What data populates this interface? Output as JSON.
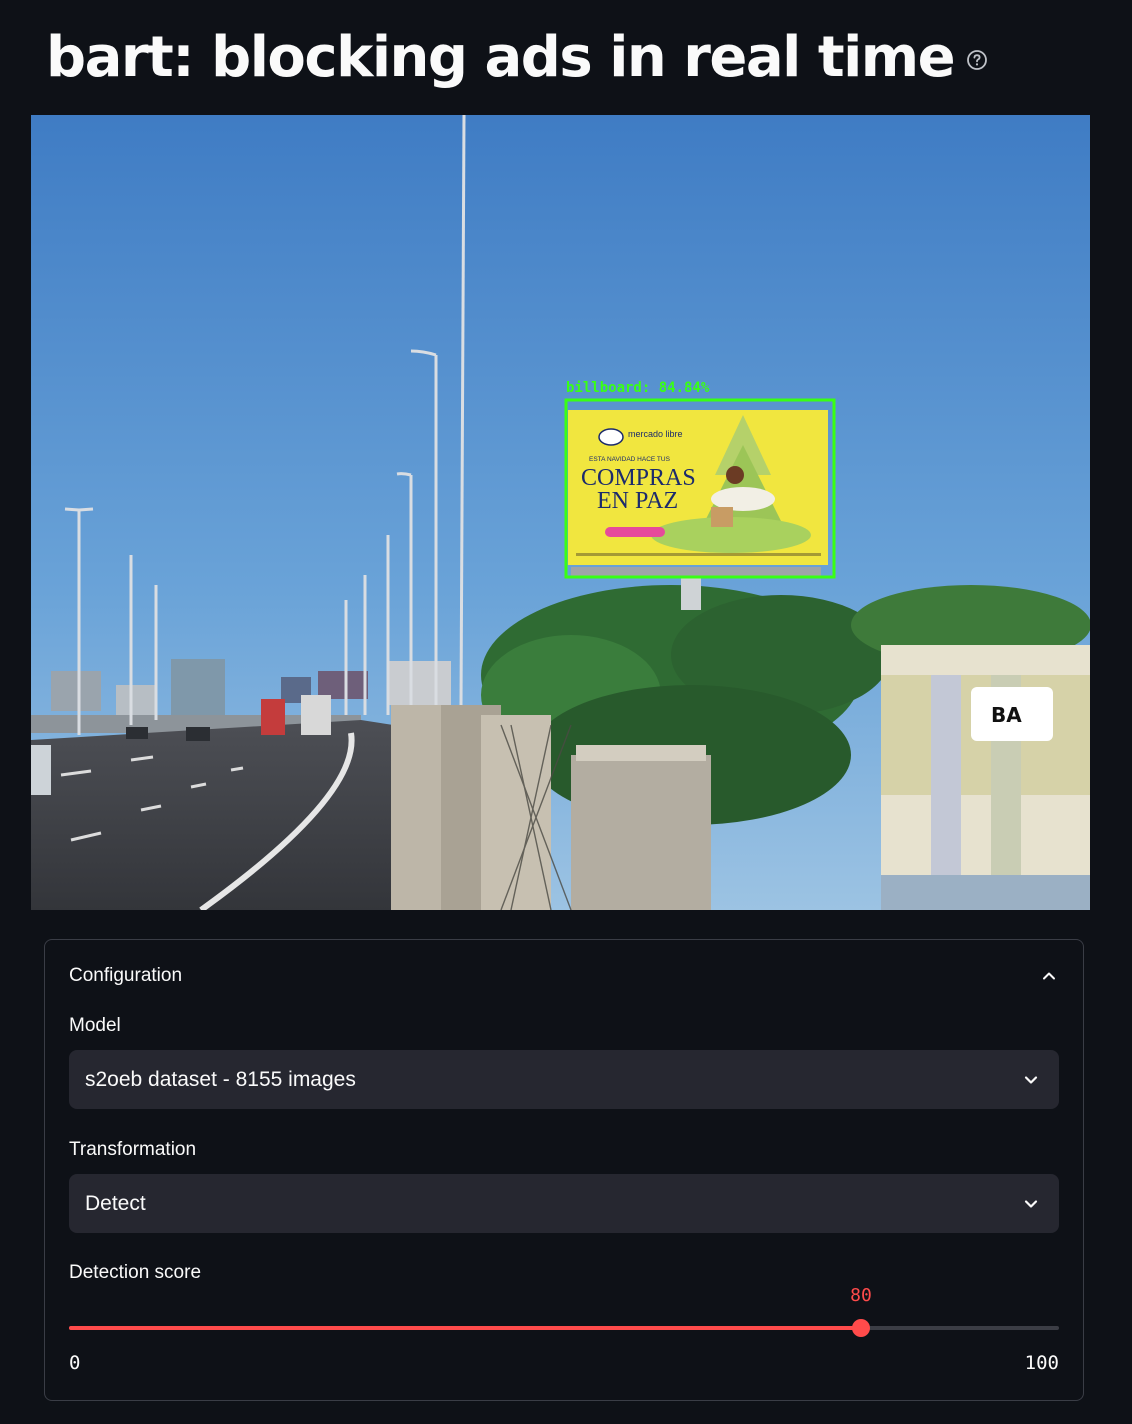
{
  "header": {
    "title": "bart: blocking ads in real time",
    "help_icon": "question-circle-icon"
  },
  "image": {
    "detection_label": "billboard: 84.84%",
    "billboard": {
      "brand": "mercado libre",
      "tagline": "ESTA NAVIDAD HACE TUS",
      "headline_line1": "COMPRAS",
      "headline_line2": "EN PAZ"
    },
    "building_sign": "BA",
    "colors": {
      "detection_box": "#39ff14",
      "billboard_bg": "#f4e440",
      "sky": "#4a86c8"
    }
  },
  "config": {
    "title": "Configuration",
    "collapse_icon": "chevron-up-icon",
    "model": {
      "label": "Model",
      "value": "s2oeb dataset - 8155 images"
    },
    "transformation": {
      "label": "Transformation",
      "value": "Detect"
    },
    "detection_score": {
      "label": "Detection score",
      "value": 80,
      "value_text": "80",
      "min": "0",
      "max": "100"
    }
  },
  "theme": {
    "background": "#0e1117",
    "accent": "#ff4b4b",
    "input_bg": "#262730"
  }
}
